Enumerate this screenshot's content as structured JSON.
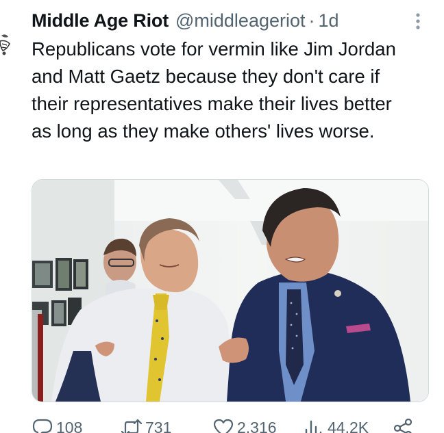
{
  "tweet": {
    "author_name": "Middle Age Riot",
    "handle": "@middleageriot",
    "separator": "·",
    "time": "1d",
    "text": "Republicans vote for vermin like Jim Jordan and Matt Gaetz because they don't care if their representatives make their lives better as long as they make others' lives worse.",
    "media_icon": "photo",
    "more_icon": "more-vertical-icon"
  },
  "actions": {
    "replies": "108",
    "reposts": "731",
    "likes": "2,316",
    "views": "44.2K",
    "icons": [
      "reply-icon",
      "repost-icon",
      "like-icon",
      "views-icon",
      "share-icon"
    ]
  },
  "colors": {
    "text": "#0f1419",
    "secondary": "#536471",
    "border": "#cfd9de"
  }
}
